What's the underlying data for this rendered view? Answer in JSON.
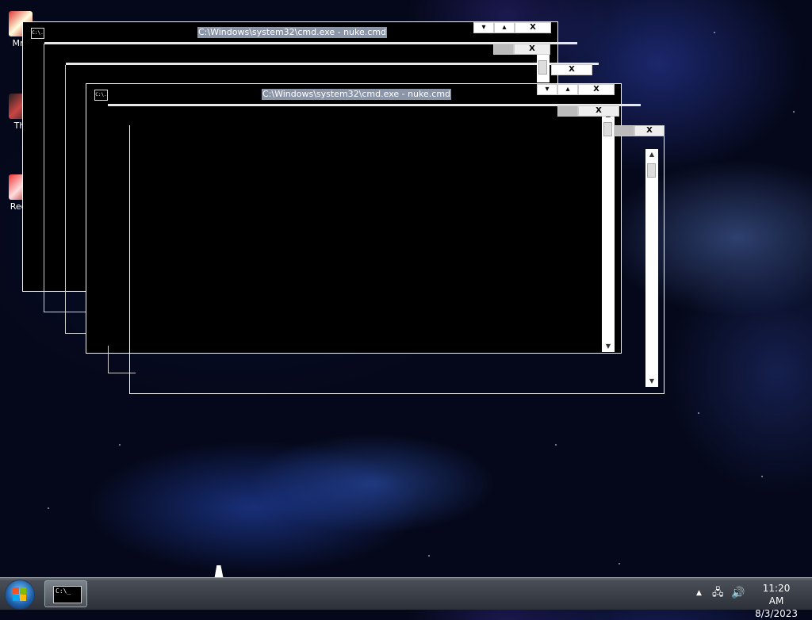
{
  "desktop": {
    "icons": [
      {
        "label": "MrE"
      },
      {
        "label": "Thi"
      },
      {
        "label": "Recy"
      }
    ]
  },
  "windows": {
    "back_title": "C:\\Windows\\system32\\cmd.exe - nuke.cmd",
    "front_title": "C:\\Windows\\system32\\cmd.exe - nuke.cmd",
    "icon_text": "C:\\.",
    "minimize_glyph": "▾",
    "maximize_glyph": "▴",
    "close_glyph": "X",
    "scroll_up": "▲",
    "scroll_down": "▼"
  },
  "taskbar": {
    "cmd_icon_text": "C:\\_",
    "tray_up_glyph": "▲",
    "net_glyph": "🖧",
    "volume_glyph": "🔊",
    "time": "11:20 AM",
    "date": "8/3/2023"
  }
}
